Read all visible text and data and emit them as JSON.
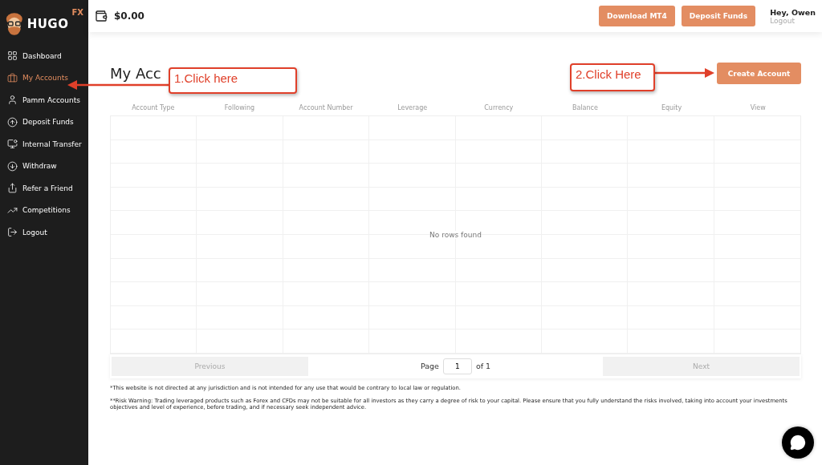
{
  "brand": {
    "name": "HUGO",
    "suffix": "FX"
  },
  "sidebar": {
    "items": [
      {
        "label": "Dashboard",
        "selected": false
      },
      {
        "label": "My Accounts",
        "selected": true
      },
      {
        "label": "Pamm Accounts",
        "selected": false
      },
      {
        "label": "Deposit Funds",
        "selected": false
      },
      {
        "label": "Internal Transfer",
        "selected": false
      },
      {
        "label": "Withdraw",
        "selected": false
      },
      {
        "label": "Refer a Friend",
        "selected": false
      },
      {
        "label": "Competitions",
        "selected": false
      },
      {
        "label": "Logout",
        "selected": false
      }
    ]
  },
  "header": {
    "balance": "$0.00",
    "buttons": [
      "Download MT4",
      "Deposit Funds"
    ],
    "greeting": "Hey, Owen",
    "logout": "Logout"
  },
  "page": {
    "title": "My Acc",
    "create_button": "Create Account"
  },
  "table": {
    "columns": [
      "Account Type",
      "Following",
      "Account Number",
      "Leverage",
      "Currency",
      "Balance",
      "Equity",
      "View"
    ],
    "empty_message": "No rows found"
  },
  "pagination": {
    "previous": "Previous",
    "page_label": "Page",
    "page": "1",
    "of": "of 1",
    "next": "Next"
  },
  "footnotes": [
    "*This website is not directed at any jurisdiction and is not intended for any use that would be contrary to local law or regulation.",
    "**Risk Warning: Trading leveraged products such as Forex and CFDs may not be suitable for all investors as they carry a degree of risk to your capital. Please ensure that you fully understand the risks involved, taking into account your investments objectives and level of experience, before trading, and if necessary seek independent advice."
  ],
  "callouts": [
    "1.Click here",
    "2.Click Here"
  ]
}
